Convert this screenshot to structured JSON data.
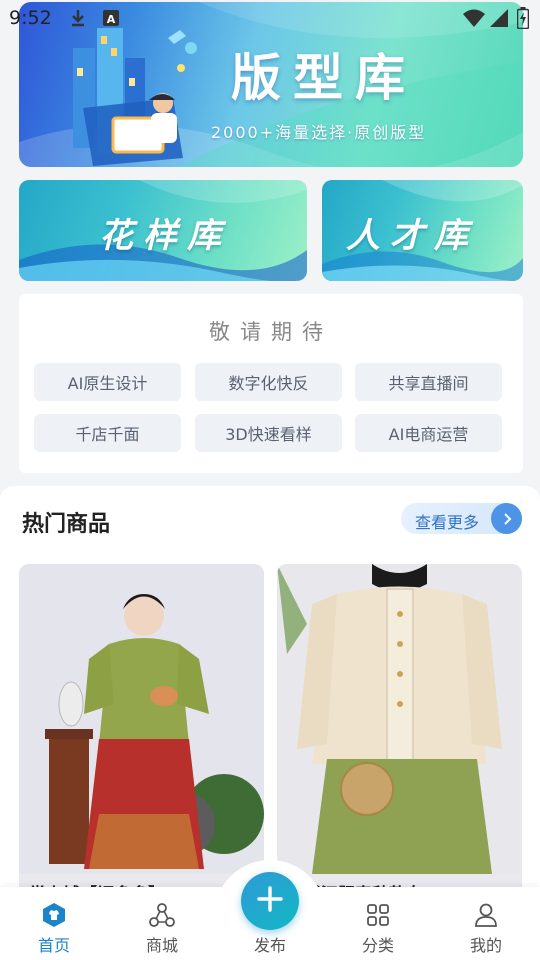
{
  "status_bar": {
    "time": "9:52",
    "icons": [
      "download-icon",
      "app-a-icon",
      "wifi-icon",
      "signal-icon",
      "battery-icon"
    ]
  },
  "banners": {
    "main": {
      "title": "版型库",
      "subtitle": "2000+海量选择·原创版型"
    },
    "pattern": {
      "title": "花样库"
    },
    "talent": {
      "title": "人才库"
    }
  },
  "coming_soon": {
    "title": "敬请期待",
    "items": [
      "AI原生设计",
      "数字化快反",
      "共享直播间",
      "千店千面",
      "3D快速看样",
      "AI电商运营"
    ]
  },
  "hot_products": {
    "title": "热门商品",
    "view_more": "查看更多",
    "items": [
      {
        "name": "掌上铺【福多多】",
        "image": "hanfu-green-red-skirt-photo"
      },
      {
        "name": "心铺汉服春秋款女",
        "image": "hanfu-cream-green-skirt-photo"
      }
    ]
  },
  "bottom_nav": {
    "items": [
      {
        "label": "首页",
        "icon": "home-shirt-icon",
        "active": true
      },
      {
        "label": "商城",
        "icon": "mall-icon",
        "active": false
      },
      {
        "label": "发布",
        "icon": "plus-icon",
        "active": false
      },
      {
        "label": "分类",
        "icon": "category-grid-icon",
        "active": false
      },
      {
        "label": "我的",
        "icon": "user-icon",
        "active": false
      }
    ]
  },
  "colors": {
    "accent": "#1a85c8",
    "publish_gradient_start": "#2f9ad6",
    "publish_gradient_end": "#12b8c5",
    "view_more_text": "#2f73c9"
  }
}
